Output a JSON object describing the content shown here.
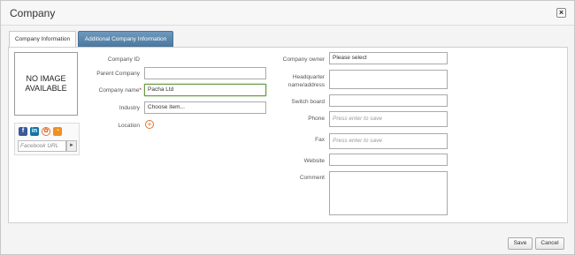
{
  "dialog": {
    "title": "Company",
    "close_label": "×"
  },
  "tabs": [
    {
      "label": "Company Information",
      "active": true
    },
    {
      "label": "Additional Company Information",
      "active": false
    }
  ],
  "image_placeholder": {
    "line1": "NO IMAGE",
    "line2": "AVAILABLE"
  },
  "social": {
    "facebook_icon": "f",
    "linkedin_icon": "in",
    "gear_icon": "✿",
    "rss_icon": "◔",
    "url_placeholder": "Facebook URL",
    "go_icon": "►"
  },
  "left_form": {
    "company_id_label": "Company ID",
    "parent_company_label": "Parent Company",
    "parent_company_value": "",
    "company_name_label": "Company name",
    "company_name_required": "*",
    "company_name_value": "Pacha Ltd",
    "industry_label": "Industry",
    "industry_value": "Choose item...",
    "location_label": "Location",
    "location_add_icon": "+"
  },
  "right_form": {
    "owner_label": "Company owner",
    "owner_value": "Please select",
    "hq_label_line1": "Headquarter",
    "hq_label_line2": "name/address",
    "switchboard_label": "Switch board",
    "phone_label": "Phone",
    "phone_placeholder": "Press enter to save",
    "fax_label": "Fax",
    "fax_placeholder": "Press enter to save",
    "website_label": "Website",
    "comment_label": "Comment"
  },
  "footer": {
    "save_label": "Save",
    "cancel_label": "Cancel"
  }
}
